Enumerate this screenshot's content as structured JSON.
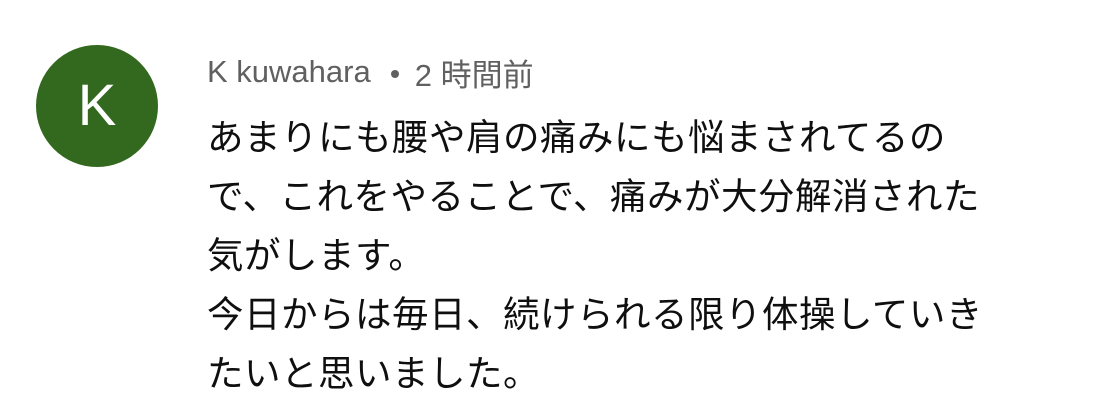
{
  "comment": {
    "avatar_letter": "K",
    "avatar_color": "#33691e",
    "author": "K kuwahara",
    "timestamp": "2 時間前",
    "text_lines": [
      "あまりにも腰や肩の痛みにも悩まされてるの",
      "で、これをやることで、痛みが大分解消された",
      "気がします。",
      "今日からは毎日、続けられる限り体操していき",
      "たいと思いました。"
    ]
  }
}
